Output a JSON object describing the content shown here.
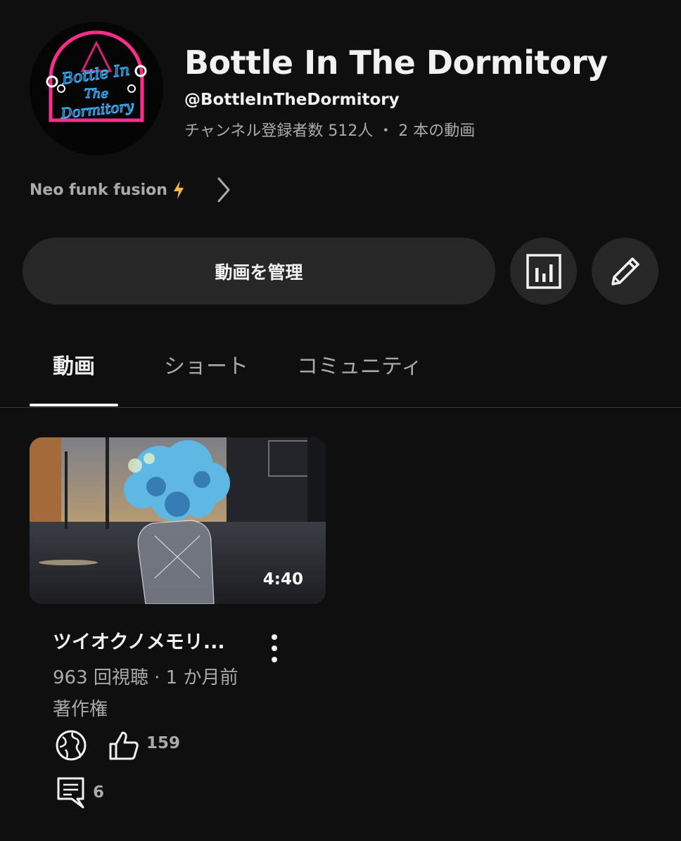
{
  "channel": {
    "logo_text": [
      "Bottle In",
      "The",
      "Dormitory"
    ],
    "title": "Bottle In The Dormitory",
    "handle": "@BottleInTheDormitory",
    "stats": "チャンネル登録者数 512人 ・ 2 本の動画",
    "description": "Neo funk fusion"
  },
  "actions": {
    "manage_videos_label": "動画を管理"
  },
  "tabs": [
    {
      "label": "動画",
      "selected": true
    },
    {
      "label": "ショート",
      "selected": false
    },
    {
      "label": "コミュニティ",
      "selected": false
    }
  ],
  "video": {
    "duration": "4:40",
    "title": "ツイオクノメモリ...",
    "meta": "963 回視聴 · 1 か月前",
    "copyright": "著作権",
    "likes": "159",
    "comments": "6"
  },
  "colors": {
    "background": "#0f0f0f",
    "button_bg": "#272727",
    "text_primary": "#f1f1f1",
    "text_secondary": "#aaaaaa",
    "bolt": "#f5b942",
    "logo_pink": "#ff2d8a",
    "logo_blue": "#3ab4ff"
  },
  "icons": {
    "analytics": "bar-chart-icon",
    "edit": "pencil-icon",
    "more": "vertical-dots-icon",
    "visibility": "globe-icon",
    "like": "thumbs-up-icon",
    "comments": "comment-icon",
    "description": "lightning-bolt-icon",
    "chevron": "chevron-right-icon"
  }
}
